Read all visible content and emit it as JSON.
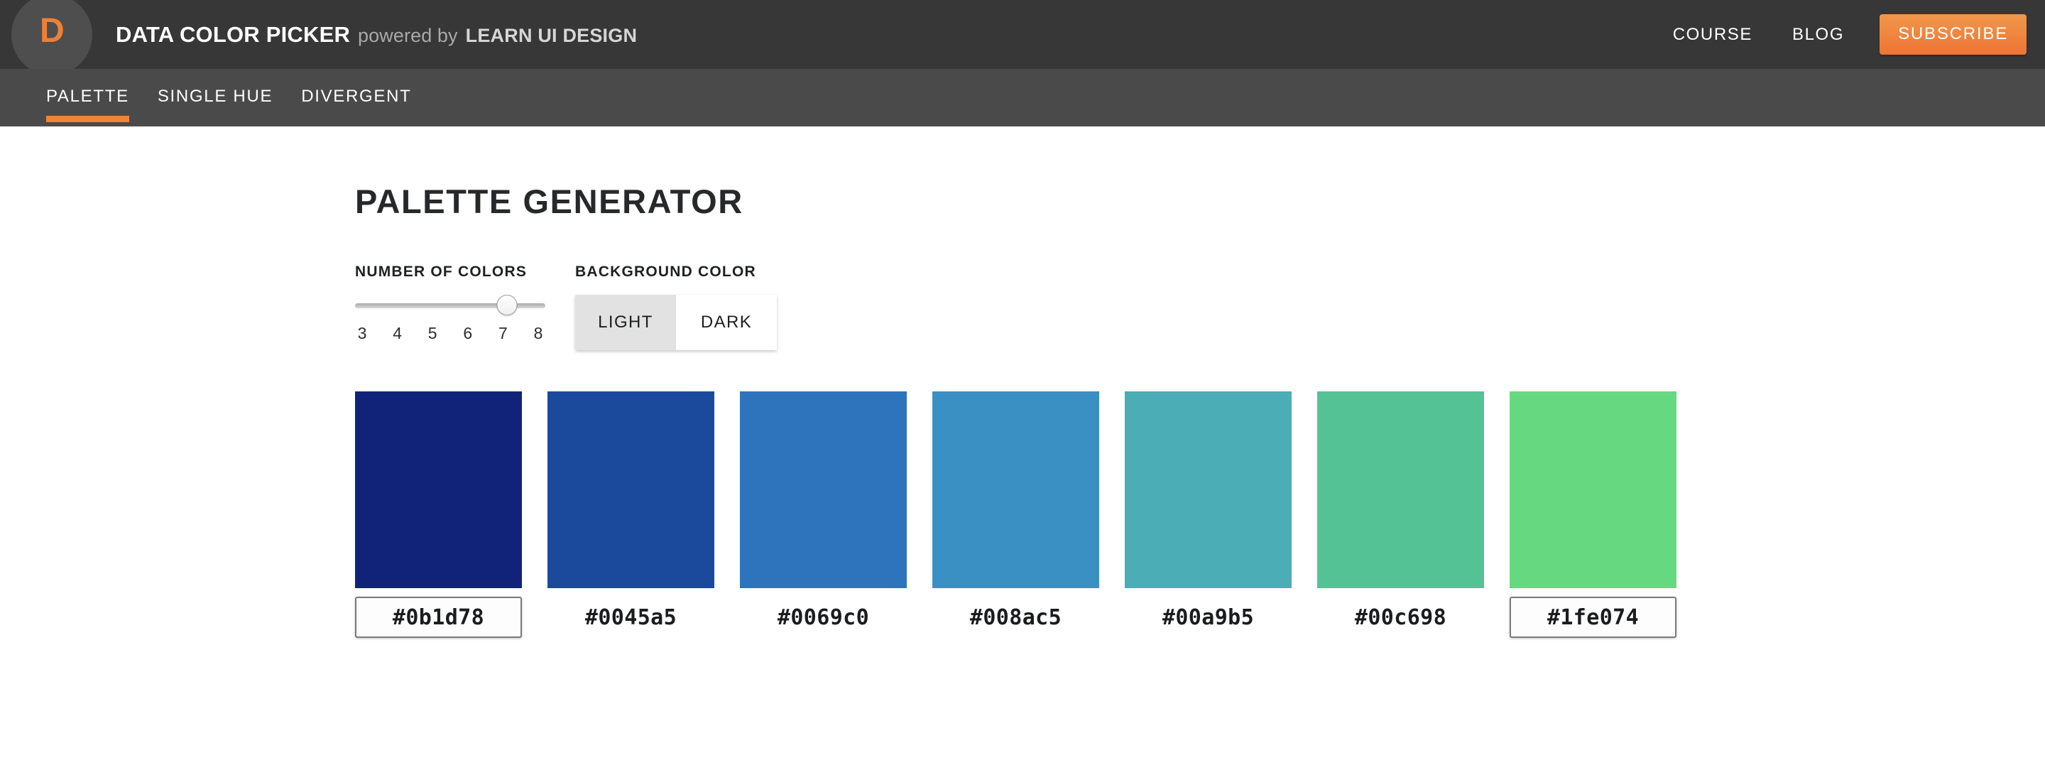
{
  "header": {
    "logo_letter": "D",
    "brand_main": "DATA COLOR PICKER",
    "brand_powered": "powered by",
    "brand_by": "LEARN UI DESIGN",
    "nav": [
      {
        "label": "COURSE"
      },
      {
        "label": "BLOG"
      }
    ],
    "subscribe_label": "SUBSCRIBE",
    "accent_color": "#ef7435",
    "bar_color": "#373737"
  },
  "subnav": {
    "bar_color": "#4a4a4a",
    "underline_color": "#ef8437",
    "tabs": [
      {
        "label": "PALETTE",
        "active": true
      },
      {
        "label": "SINGLE HUE",
        "active": false
      },
      {
        "label": "DIVERGENT",
        "active": false
      }
    ]
  },
  "main": {
    "page_title": "PALETTE GENERATOR",
    "number_of_colors": {
      "label": "NUMBER OF COLORS",
      "value": 7,
      "min": 3,
      "max": 8,
      "ticks": [
        "3",
        "4",
        "5",
        "6",
        "7",
        "8"
      ]
    },
    "background_color": {
      "label": "BACKGROUND COLOR",
      "options": [
        {
          "label": "LIGHT",
          "selected": true
        },
        {
          "label": "DARK",
          "selected": false
        }
      ]
    },
    "palette": [
      {
        "hex": "#0b1d78",
        "swatch": "#112378",
        "boxed": true
      },
      {
        "hex": "#0045a5",
        "swatch": "#1b4a9c",
        "boxed": false
      },
      {
        "hex": "#0069c0",
        "swatch": "#2d74bd",
        "boxed": false
      },
      {
        "hex": "#008ac5",
        "swatch": "#3b90c3",
        "boxed": false
      },
      {
        "hex": "#00a9b5",
        "swatch": "#4badb5",
        "boxed": false
      },
      {
        "hex": "#00c698",
        "swatch": "#55c295",
        "boxed": false
      },
      {
        "hex": "#1fe074",
        "swatch": "#66d880",
        "boxed": true
      }
    ]
  }
}
